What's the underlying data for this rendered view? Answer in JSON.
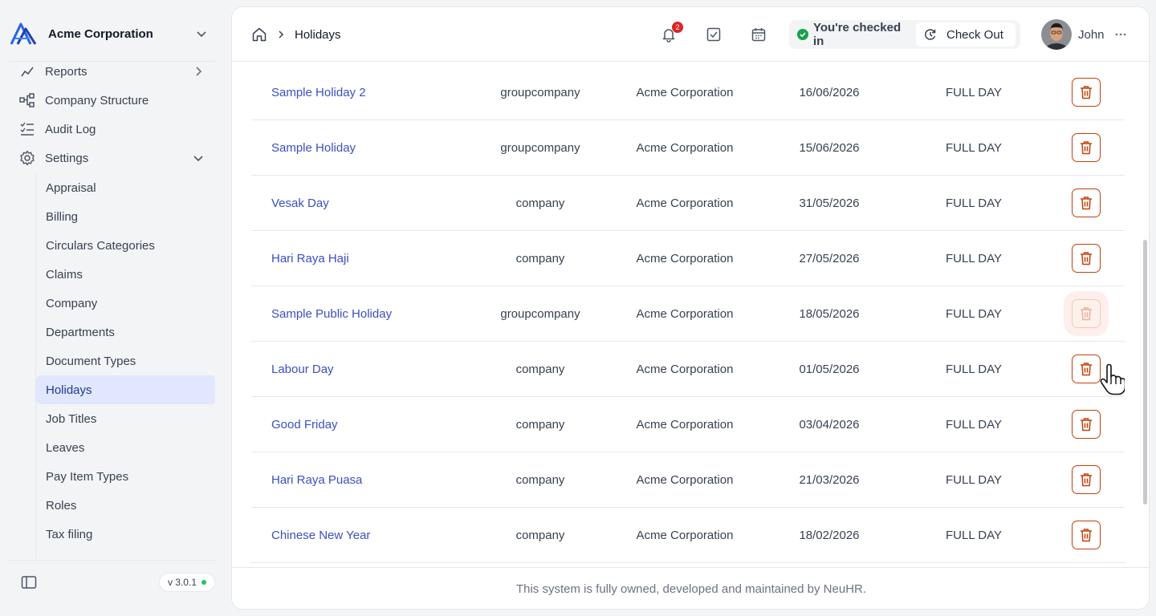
{
  "org": {
    "name": "Acme Corporation"
  },
  "sidebar": {
    "items": [
      {
        "label": "Reports"
      },
      {
        "label": "Company Structure"
      },
      {
        "label": "Audit Log"
      },
      {
        "label": "Settings"
      }
    ],
    "settings_sub": [
      {
        "label": "Appraisal"
      },
      {
        "label": "Billing"
      },
      {
        "label": "Circulars Categories"
      },
      {
        "label": "Claims"
      },
      {
        "label": "Company"
      },
      {
        "label": "Departments"
      },
      {
        "label": "Document Types"
      },
      {
        "label": "Holidays",
        "active": true
      },
      {
        "label": "Job Titles"
      },
      {
        "label": "Leaves"
      },
      {
        "label": "Pay Item Types"
      },
      {
        "label": "Roles"
      },
      {
        "label": "Tax filing"
      }
    ],
    "version": "v 3.0.1"
  },
  "header": {
    "breadcrumb_page": "Holidays",
    "notification_count": "2",
    "checked_in_label": "You're checked in",
    "checkout_label": "Check Out",
    "user_name": "John"
  },
  "table": {
    "rows": [
      {
        "name": "Sample Holiday 2",
        "type": "groupcompany",
        "company": "Acme Corporation",
        "date": "16/06/2026",
        "duration": "FULL DAY"
      },
      {
        "name": "Sample Holiday",
        "type": "groupcompany",
        "company": "Acme Corporation",
        "date": "15/06/2026",
        "duration": "FULL DAY"
      },
      {
        "name": "Vesak Day",
        "type": "company",
        "company": "Acme Corporation",
        "date": "31/05/2026",
        "duration": "FULL DAY"
      },
      {
        "name": "Hari Raya Haji",
        "type": "company",
        "company": "Acme Corporation",
        "date": "27/05/2026",
        "duration": "FULL DAY"
      },
      {
        "name": "Sample Public Holiday",
        "type": "groupcompany",
        "company": "Acme Corporation",
        "date": "18/05/2026",
        "duration": "FULL DAY"
      },
      {
        "name": "Labour Day",
        "type": "company",
        "company": "Acme Corporation",
        "date": "01/05/2026",
        "duration": "FULL DAY"
      },
      {
        "name": "Good Friday",
        "type": "company",
        "company": "Acme Corporation",
        "date": "03/04/2026",
        "duration": "FULL DAY"
      },
      {
        "name": "Hari Raya Puasa",
        "type": "company",
        "company": "Acme Corporation",
        "date": "21/03/2026",
        "duration": "FULL DAY"
      },
      {
        "name": "Chinese New Year",
        "type": "company",
        "company": "Acme Corporation",
        "date": "18/02/2026",
        "duration": "FULL DAY"
      }
    ]
  },
  "footer": {
    "text": "This system is fully owned, developed and maintained by NeuHR."
  },
  "colors": {
    "accent": "#3b4fc4",
    "danger": "#c2410c",
    "active_bg": "#e0e7ff",
    "status_ok": "#16a34a"
  }
}
